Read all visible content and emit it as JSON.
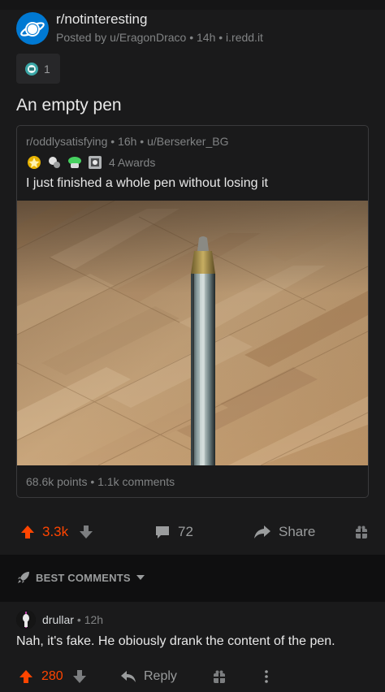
{
  "post": {
    "subreddit": "r/notinteresting",
    "posted_line": "Posted by u/EragonDraco • 14h • i.redd.it",
    "award_count": "1",
    "title": "An empty pen"
  },
  "crosspost": {
    "meta": "r/oddlysatisfying • 16h • u/Berserker_BG",
    "awards_label": "4 Awards",
    "title": "I just finished a whole pen without losing it",
    "stats": "68.6k points • 1.1k comments"
  },
  "actions": {
    "upvotes": "3.3k",
    "comments": "72",
    "share_label": "Share"
  },
  "sort": {
    "label": "BEST COMMENTS"
  },
  "comment": {
    "user": "drullar",
    "time": "• 12h",
    "body": "Nah, it's fake. He obiously drank the content of the pen.",
    "upvotes": "280",
    "reply_label": "Reply"
  },
  "colors": {
    "background": "#1a1a1b",
    "upvote_accent": "#ff4500",
    "subreddit_blue": "#0079d3",
    "muted_text": "#818384"
  },
  "icons": {
    "subreddit": "planet-icon",
    "upvote": "arrow-up-icon",
    "downvote": "arrow-down-icon",
    "comments": "speech-bubble-icon",
    "share": "share-arrow-icon",
    "award": "gift-icon",
    "sort": "rocket-icon",
    "more": "kebab-icon"
  }
}
